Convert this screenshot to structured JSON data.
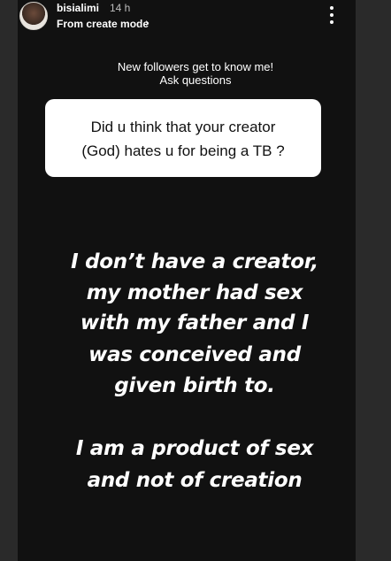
{
  "header": {
    "username": "bisialimi",
    "timestamp": "14 h",
    "subtitle": "From create mode",
    "chevron_icon": "chevron-right-icon",
    "more_icon": "vertical-ellipsis-icon"
  },
  "sticker": {
    "prompt_line1": "New followers get to know me!",
    "prompt_line2": "Ask questions",
    "question_line1": "Did u think that your creator",
    "question_line2": "(God) hates u for being a TB ?"
  },
  "answer": {
    "lines": [
      "I don’t have a creator,",
      "my mother had sex",
      "with my father and I",
      "was conceived and",
      "given birth to.",
      "I am a product of sex",
      "and not of creation"
    ]
  }
}
